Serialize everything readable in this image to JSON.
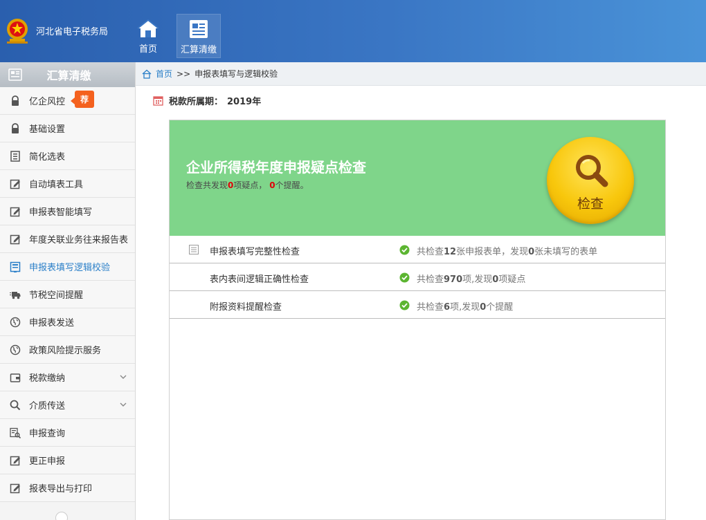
{
  "header": {
    "brand": "河北省电子税务局",
    "nav": [
      {
        "label": "首页",
        "icon": "home-icon"
      },
      {
        "label": "汇算清缴",
        "icon": "document-icon"
      }
    ]
  },
  "sidebar": {
    "title": "汇算清缴",
    "badge": "荐",
    "items": [
      {
        "label": "亿企风控",
        "icon": "lock-icon"
      },
      {
        "label": "基础设置",
        "icon": "lock-icon"
      },
      {
        "label": "简化选表",
        "icon": "list-doc-icon"
      },
      {
        "label": "自动填表工具",
        "icon": "edit-icon"
      },
      {
        "label": "申报表智能填写",
        "icon": "edit-icon"
      },
      {
        "label": "年度关联业务往来报告表",
        "icon": "edit-icon"
      },
      {
        "label": "申报表填写逻辑校验",
        "icon": "form-icon"
      },
      {
        "label": "节税空间提醒",
        "icon": "truck-icon"
      },
      {
        "label": "申报表发送",
        "icon": "globe-icon"
      },
      {
        "label": "政策风险提示服务",
        "icon": "globe-icon"
      },
      {
        "label": "税款缴纳",
        "icon": "wallet-icon"
      },
      {
        "label": "介质传送",
        "icon": "search-icon"
      },
      {
        "label": "申报查询",
        "icon": "doc-search-icon"
      },
      {
        "label": "更正申报",
        "icon": "edit-icon"
      },
      {
        "label": "报表导出与打印",
        "icon": "edit-icon"
      }
    ]
  },
  "breadcrumb": {
    "home": "首页",
    "separator": ">>",
    "current": "申报表填写与逻辑校验"
  },
  "period": {
    "label": "税款所属期：",
    "value": "2019年"
  },
  "banner": {
    "title": "企业所得税年度申报疑点检查",
    "sub_prefix": "检查共发现",
    "doubt_count": "0",
    "sub_mid": "项疑点，",
    "remind_count": "0",
    "sub_suffix": "个提醒。",
    "button_label": "检查"
  },
  "checks": [
    {
      "name": "申报表填写完整性检查",
      "pre": "共检查",
      "n1": "12",
      "mid": "张申报表单，发现",
      "n2": "0",
      "post": "张未填写的表单"
    },
    {
      "name": "表内表间逻辑正确性检查",
      "pre": "共检查",
      "n1": "970",
      "mid": "项,发现",
      "n2": "0",
      "post": "项疑点"
    },
    {
      "name": "附报资料提醒检查",
      "pre": "共检查",
      "n1": "6",
      "mid": "项,发现",
      "n2": "0",
      "post": "个提醒"
    }
  ],
  "colors": {
    "header_start": "#2a5fae",
    "header_end": "#4a93d8",
    "banner": "#7fd58a",
    "active_text": "#2a7fc8",
    "badge": "#f4611e",
    "highlight_red": "#e0000a",
    "check_green": "#5cb531"
  }
}
